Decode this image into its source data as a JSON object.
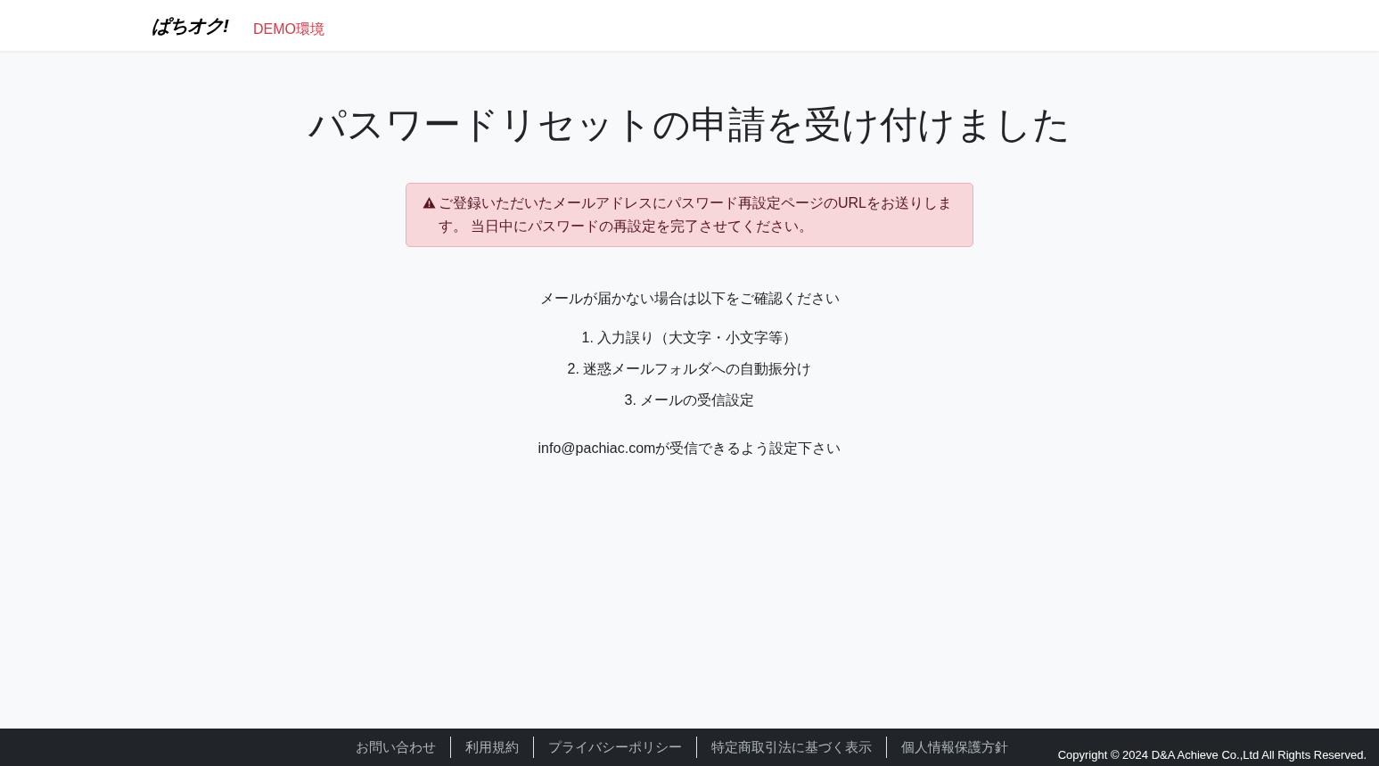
{
  "header": {
    "logo": "ぱちオク!",
    "environment_badge": "DEMO環境"
  },
  "title": "パスワードリセットの申請を受け付けました",
  "alert": {
    "text": "ご登録いただいたメールアドレスにパスワード再設定ページのURLをお送りします。 当日中にパスワードの再設定を完了させてください。"
  },
  "intro": "メールが届かない場合は以下をご確認ください",
  "checklist": [
    "1. 入力誤り（大文字・小文字等）",
    "2. 迷惑メールフォルダへの自動振分け",
    "3. メールの受信設定"
  ],
  "note": "info@pachiac.comが受信できるよう設定下さい",
  "footer": {
    "links": [
      "お問い合わせ",
      "利用規約",
      "プライバシーポリシー",
      "特定商取引法に基づく表示",
      "個人情報保護方針"
    ],
    "copyright": "Copyright © 2024 D&A Achieve Co.,Ltd All Rights Reserved."
  }
}
